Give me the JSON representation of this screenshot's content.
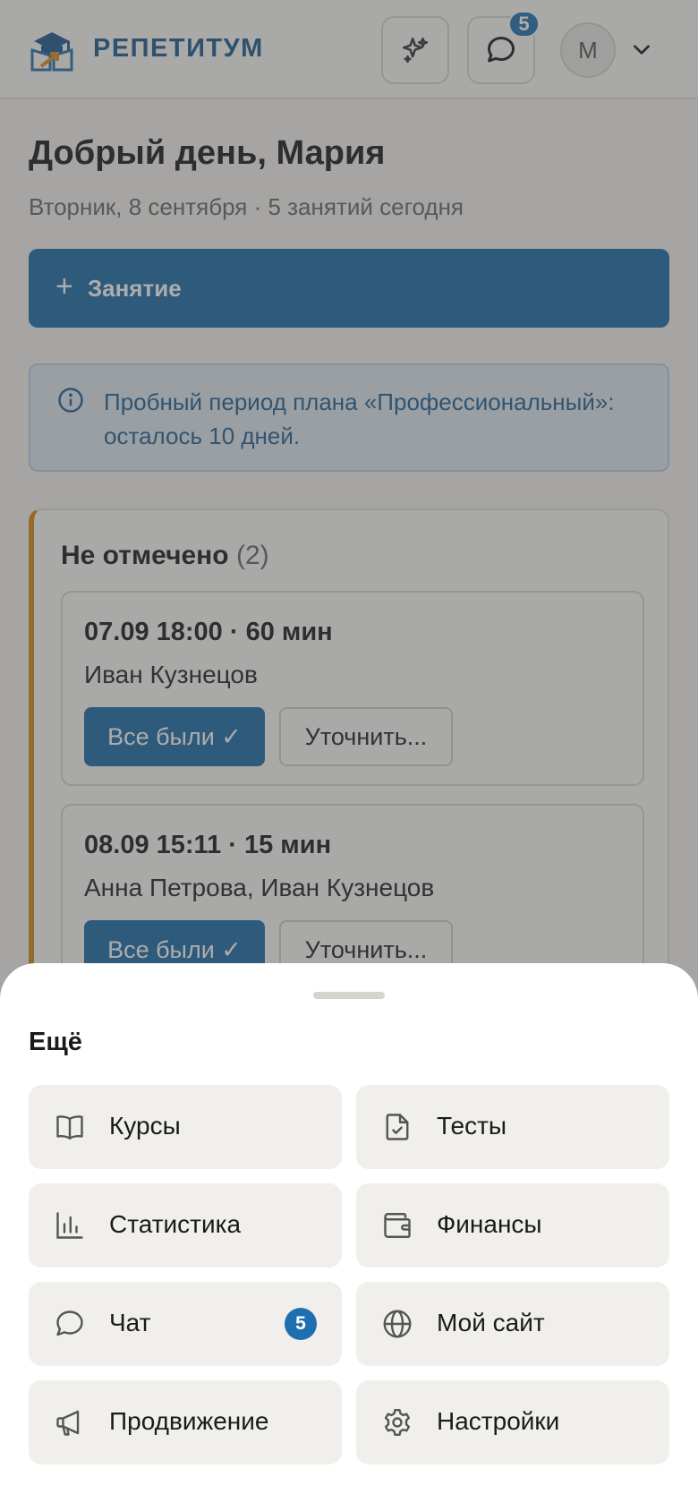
{
  "header": {
    "brand": "РЕПЕТИТУМ",
    "chat_badge": "5",
    "avatar_initial": "М"
  },
  "main": {
    "greeting": "Добрый день, Мария",
    "subtitle": "Вторник, 8 сентября · 5 занятий сегодня",
    "add_lesson_label": "Занятие",
    "trial_notice": "Пробный период плана «Профессиональный»: осталось 10 дней.",
    "unmarked": {
      "title": "Не отмечено",
      "count": "(2)",
      "lessons": [
        {
          "time": "07.09 18:00 · 60 мин",
          "students": "Иван Кузнецов",
          "all_present_label": "Все были ✓",
          "clarify_label": "Уточнить..."
        },
        {
          "time": "08.09 15:11 · 15 мин",
          "students": "Анна Петрова, Иван Кузнецов",
          "all_present_label": "Все были ✓",
          "clarify_label": "Уточнить..."
        }
      ]
    }
  },
  "sheet": {
    "title": "Ещё",
    "items": [
      {
        "label": "Курсы",
        "icon": "book-icon"
      },
      {
        "label": "Тесты",
        "icon": "file-check-icon"
      },
      {
        "label": "Статистика",
        "icon": "bar-chart-icon"
      },
      {
        "label": "Финансы",
        "icon": "wallet-icon"
      },
      {
        "label": "Чат",
        "icon": "message-icon",
        "badge": "5"
      },
      {
        "label": "Мой сайт",
        "icon": "globe-icon"
      },
      {
        "label": "Продвижение",
        "icon": "megaphone-icon"
      },
      {
        "label": "Настройки",
        "icon": "gear-icon"
      }
    ]
  },
  "colors": {
    "accent": "#1b6aa8",
    "warning_border": "#d08a15",
    "badge": "#1f6fb0"
  }
}
